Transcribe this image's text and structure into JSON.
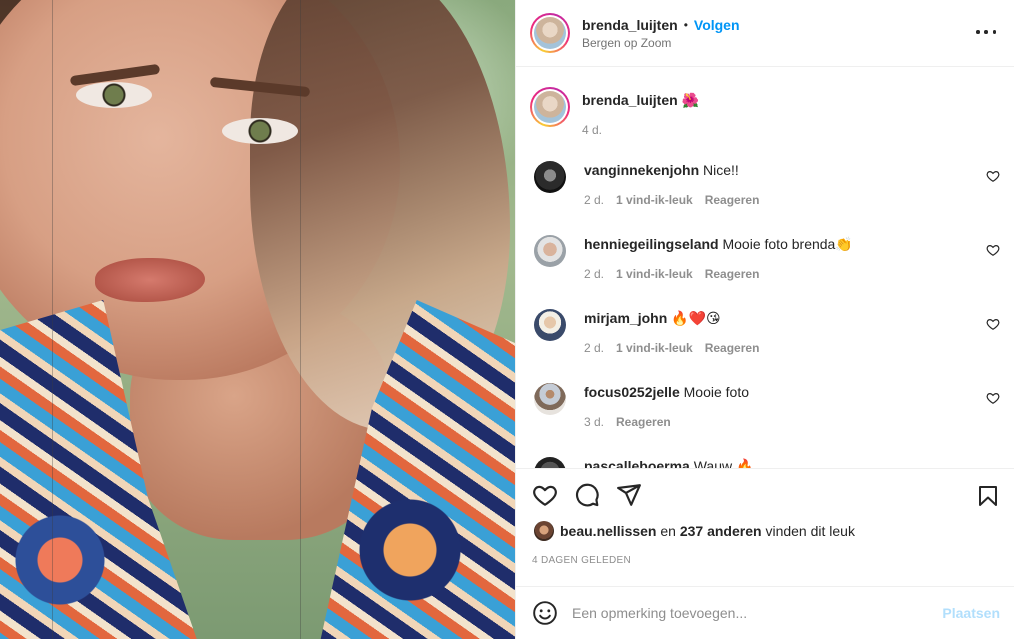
{
  "post": {
    "author": "brenda_luijten",
    "location": "Bergen op Zoom",
    "follow_label": "Volgen",
    "dot": "•",
    "caption_emoji": "🌺",
    "caption_age": "4 d."
  },
  "comments": [
    {
      "user": "vanginnekenjohn",
      "text": "Nice!!",
      "age": "2 d.",
      "likes": "1 vind-ik-leuk",
      "reply": "Reageren"
    },
    {
      "user": "henniegeilingseland",
      "text": "Mooie foto brenda👏",
      "age": "2 d.",
      "likes": "1 vind-ik-leuk",
      "reply": "Reageren"
    },
    {
      "user": "mirjam_john",
      "text": "🔥❤️😘",
      "age": "2 d.",
      "likes": "1 vind-ik-leuk",
      "reply": "Reageren"
    },
    {
      "user": "focus0252jelle",
      "text": "Mooie foto",
      "age": "3 d.",
      "reply": "Reageren"
    },
    {
      "user": "pascalleboerma",
      "text": "Wauw 🔥"
    }
  ],
  "likes": {
    "user": "beau.nellissen",
    "and": "en",
    "count": "237 anderen",
    "suffix": "vinden dit leuk"
  },
  "date": "4 DAGEN GELEDEN",
  "add_comment": {
    "placeholder": "Een opmerking toevoegen...",
    "post_label": "Plaatsen"
  },
  "icons": [
    "more-icon",
    "heart-icon",
    "comment-icon",
    "share-icon",
    "bookmark-icon",
    "emoji-icon"
  ],
  "colors": {
    "accent": "#0095f6",
    "post_disabled": "#b2dffc",
    "text": "#262626",
    "muted": "#8e8e8e"
  }
}
